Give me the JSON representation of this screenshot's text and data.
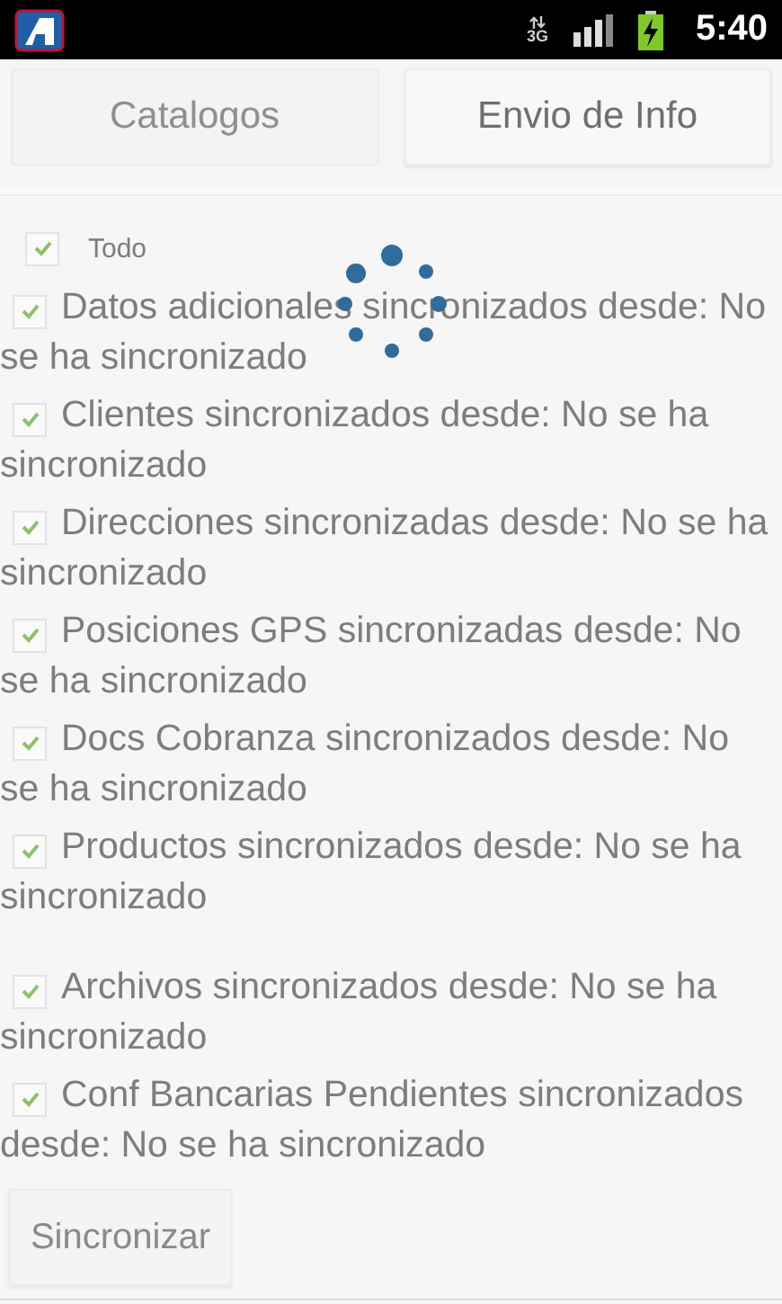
{
  "status_bar": {
    "network_type": "3G",
    "time": "5:40"
  },
  "tabs": [
    {
      "label": "Catalogos",
      "selected": true
    },
    {
      "label": "Envio de Info",
      "selected": false
    }
  ],
  "select_all": {
    "label": "Todo",
    "checked": true
  },
  "items": [
    {
      "label": "Datos adicionales sincronizados desde: No se ha sincronizado",
      "checked": true,
      "gap_before": false
    },
    {
      "label": "Clientes sincronizados desde: No se ha sincronizado",
      "checked": true,
      "gap_before": false
    },
    {
      "label": "Direcciones sincronizadas desde: No se ha sincronizado",
      "checked": true,
      "gap_before": false
    },
    {
      "label": "Posiciones GPS sincronizadas desde: No se ha sincronizado",
      "checked": true,
      "gap_before": false
    },
    {
      "label": "Docs Cobranza sincronizados desde: No se ha sincronizado",
      "checked": true,
      "gap_before": false
    },
    {
      "label": "Productos sincronizados desde: No se ha sincronizado",
      "checked": true,
      "gap_before": false
    },
    {
      "label": "Archivos sincronizados desde: No se ha sincronizado",
      "checked": true,
      "gap_before": true
    },
    {
      "label": "Conf Bancarias Pendientes sincronizados desde: No se ha sincronizado",
      "checked": true,
      "gap_before": false
    }
  ],
  "sync_button": "Sincronizar",
  "loading": true
}
